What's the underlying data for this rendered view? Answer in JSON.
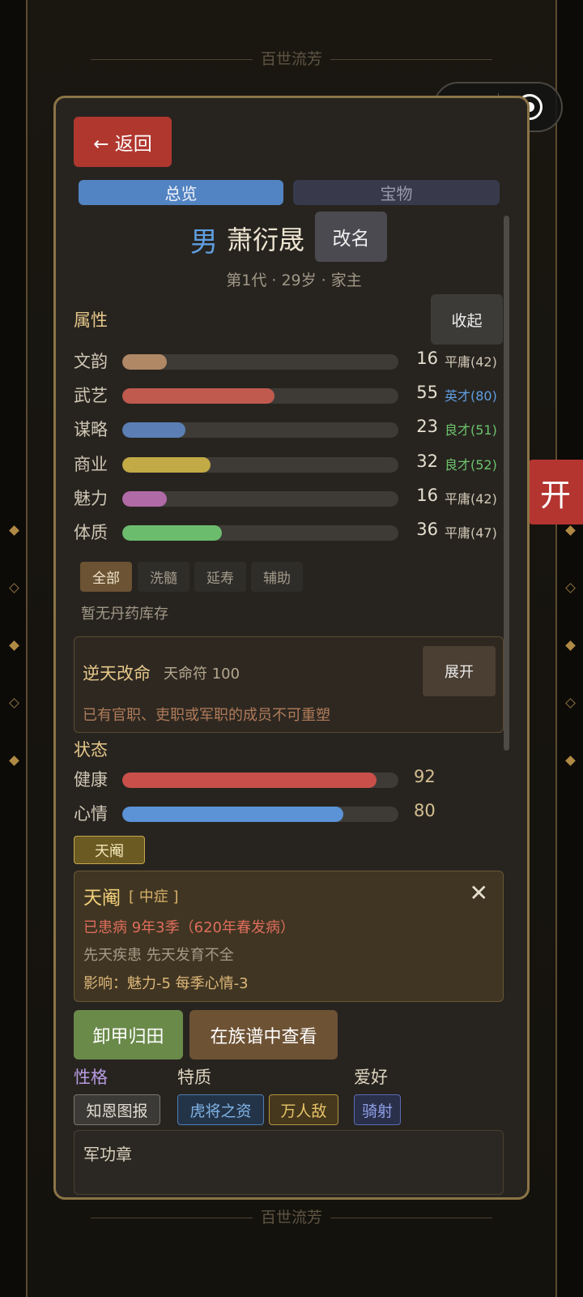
{
  "background": {
    "title_top": "百世流芳",
    "title_bottom": "百世流芳"
  },
  "side_button": {
    "label": "开"
  },
  "capsule": {
    "menu_icon": "more-dots-icon",
    "close_icon": "target-ring-icon"
  },
  "modal": {
    "back_label": "← 返回",
    "tabs": [
      {
        "label": "总览",
        "active": true
      },
      {
        "label": "宝物",
        "active": false
      }
    ],
    "character": {
      "gender": "男",
      "name": "萧衍晟",
      "rename_label": "改名",
      "subinfo": "第1代 · 29岁 · 家主"
    },
    "attributes_section": {
      "title": "属性",
      "collapse_label": "收起",
      "items": [
        {
          "label": "文韵",
          "value": "16",
          "grade": "平庸(42)",
          "fill_percent": 16,
          "color": "#b08866",
          "grade_color": "#cfc6b4"
        },
        {
          "label": "武艺",
          "value": "55",
          "grade": "英才(80)",
          "fill_percent": 55,
          "color": "#c05a4e",
          "grade_color": "#5f9ee0"
        },
        {
          "label": "谋略",
          "value": "23",
          "grade": "良才(51)",
          "fill_percent": 23,
          "color": "#5b7fb4",
          "grade_color": "#6cc36b"
        },
        {
          "label": "商业",
          "value": "32",
          "grade": "良才(52)",
          "fill_percent": 32,
          "color": "#c2aa46",
          "grade_color": "#6cc36b"
        },
        {
          "label": "魅力",
          "value": "16",
          "grade": "平庸(42)",
          "fill_percent": 16,
          "color": "#b06aa6",
          "grade_color": "#cfc6b4"
        },
        {
          "label": "体质",
          "value": "36",
          "grade": "平庸(47)",
          "fill_percent": 36,
          "color": "#6cbc6e",
          "grade_color": "#cfc6b4"
        }
      ]
    },
    "pill_filters": [
      {
        "label": "全部",
        "active": true
      },
      {
        "label": "洗髓",
        "active": false
      },
      {
        "label": "延寿",
        "active": false
      },
      {
        "label": "辅助",
        "active": false
      }
    ],
    "pill_empty": "暂无丹药库存",
    "fate_change": {
      "title": "逆天改命",
      "cost": "天命符 100",
      "expand_label": "展开",
      "note": "已有官职、吏职或军职的成员不可重塑"
    },
    "status_section": {
      "title": "状态",
      "items": [
        {
          "label": "健康",
          "value": "92",
          "fill_percent": 92,
          "color": "#c9504a"
        },
        {
          "label": "心情",
          "value": "80",
          "fill_percent": 80,
          "color": "#5b93d6"
        }
      ]
    },
    "disease": {
      "tag": "天阉",
      "name": "天阉",
      "severity": "[ 中症 ]",
      "sick_info": "已患病 9年3季（620年春发病）",
      "description": "先天疾患  先天发育不全",
      "effect": "影响：魅力-5  每季心情-3"
    },
    "actions": {
      "retire": "卸甲归田",
      "view_genealogy": "在族谱中查看"
    },
    "traits": {
      "personality_title": "性格",
      "personality": [
        "知恩图报"
      ],
      "quality_title": "特质",
      "qualities": [
        "虎将之资",
        "万人敌"
      ],
      "hobby_title": "爱好",
      "hobbies": [
        "骑射"
      ]
    },
    "medal_title": "军功章"
  }
}
